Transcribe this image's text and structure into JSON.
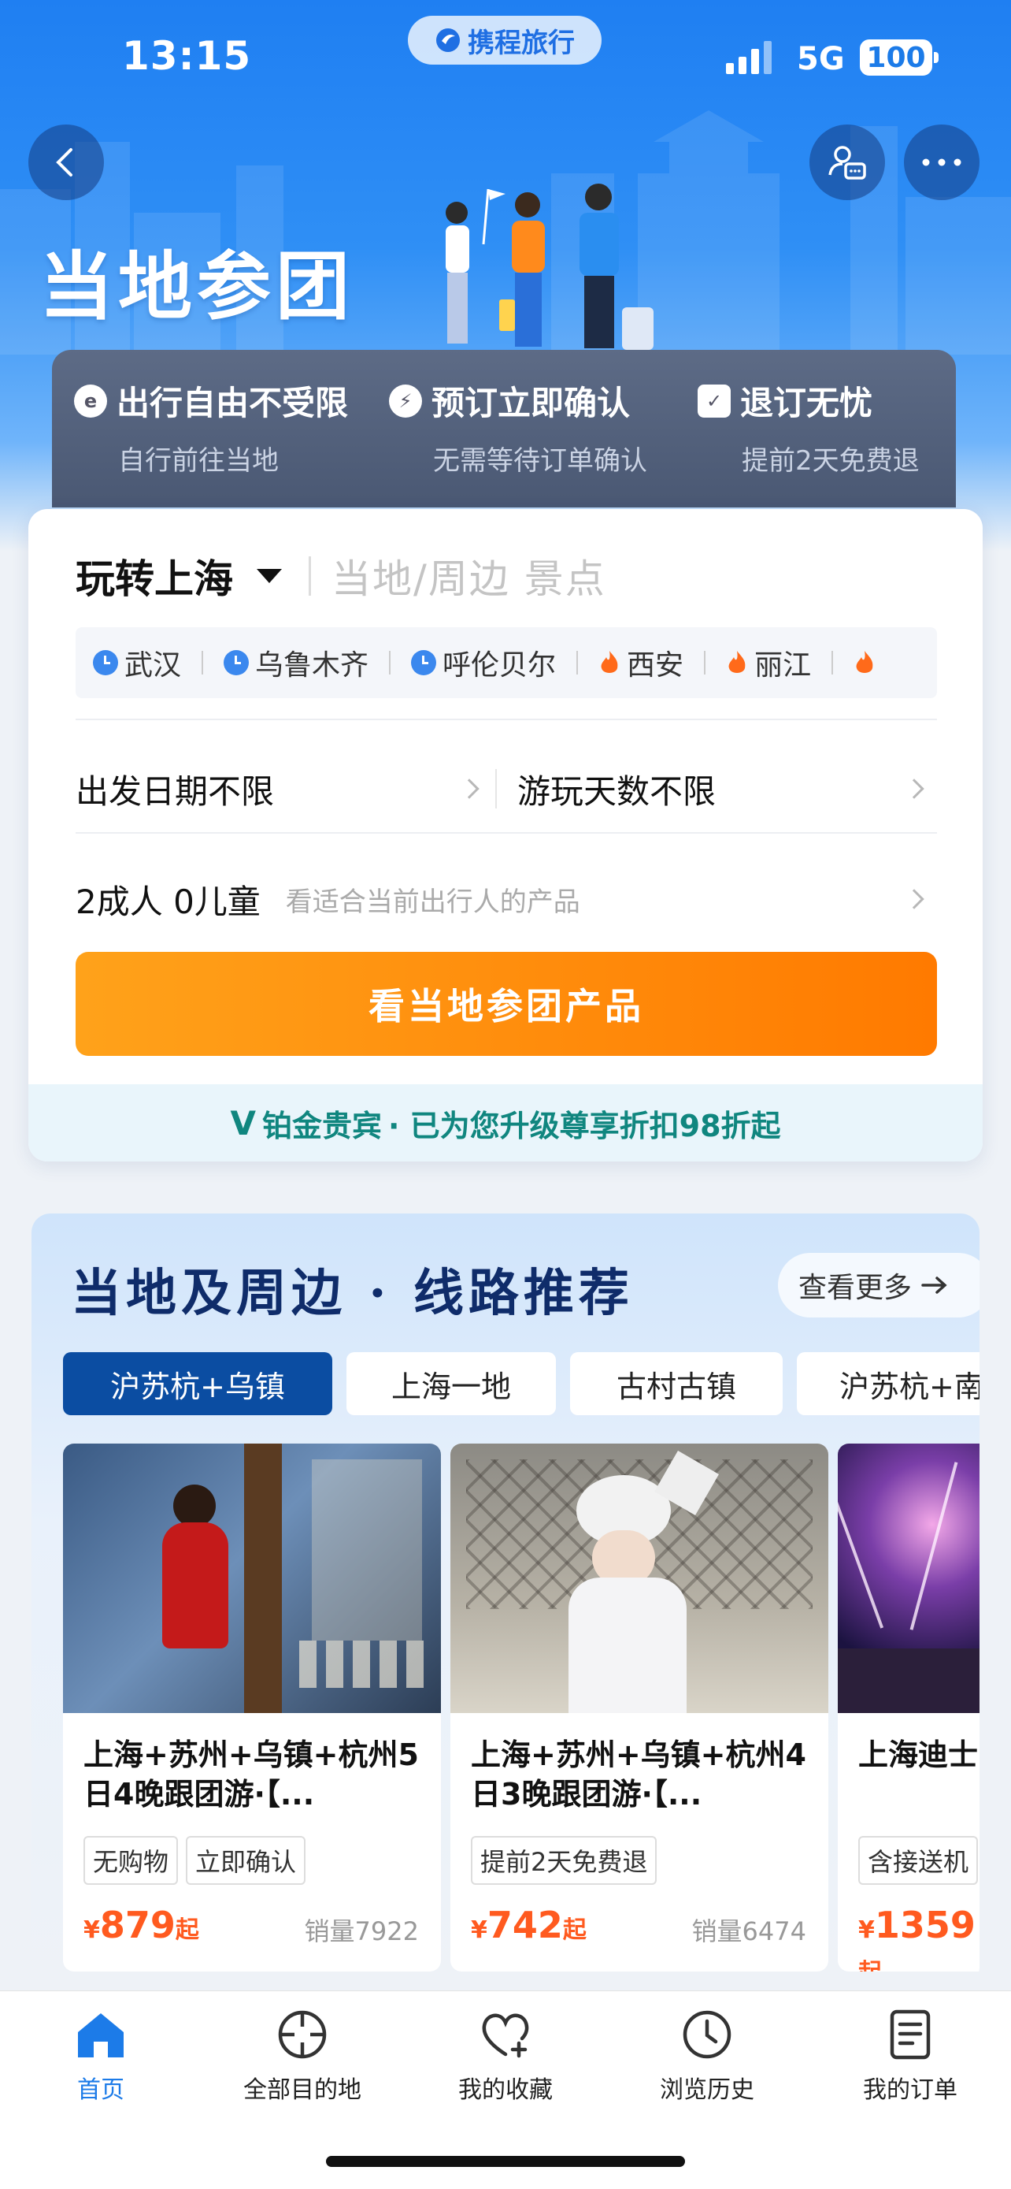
{
  "status": {
    "time": "13:15",
    "network": "5G",
    "battery": "100"
  },
  "brand": {
    "name": "携程旅行"
  },
  "header": {
    "title": "当地参团"
  },
  "benefits": [
    {
      "title": "出行自由不受限",
      "sub": "自行前往当地"
    },
    {
      "title": "预订立即确认",
      "sub": "无需等待订单确认"
    },
    {
      "title": "退订无忧",
      "sub": "提前2天免费退"
    }
  ],
  "search": {
    "city": "玩转上海",
    "placeholder": "当地/周边 景点",
    "hot_cities": [
      "武汉",
      "乌鲁木齐",
      "呼伦贝尔",
      "西安",
      "丽江"
    ],
    "date": "出发日期不限",
    "days": "游玩天数不限",
    "pax": "2成人 0儿童",
    "pax_hint": "看适合当前出行人的产品",
    "cta": "看当地参团产品",
    "vip_badge": "铂金贵宾",
    "vip_text": "· 已为您升级尊享折扣98折起"
  },
  "recs": {
    "title": "当地及周边 · 线路推荐",
    "more": "查看更多",
    "tabs": [
      "沪苏杭+乌镇",
      "上海一地",
      "古村古镇",
      "沪苏杭+南"
    ],
    "cards": [
      {
        "title": "上海+苏州+乌镇+杭州5日4晚跟团游·【...",
        "tags": [
          "无购物",
          "立即确认"
        ],
        "currency": "¥",
        "price": "879",
        "suffix": "起",
        "sales": "销量7922"
      },
      {
        "title": "上海+苏州+乌镇+杭州4日3晚跟团游·【...",
        "tags": [
          "提前2天免费退"
        ],
        "currency": "¥",
        "price": "742",
        "suffix": "起",
        "sales": "销量6474"
      },
      {
        "title": "上海迪士+苏州+",
        "tags": [
          "含接送机"
        ],
        "currency": "¥",
        "price": "1359",
        "suffix": "起",
        "sales": ""
      }
    ]
  },
  "tabbar": [
    {
      "label": "首页",
      "icon": "home-icon",
      "active": true
    },
    {
      "label": "全部目的地",
      "icon": "target-icon",
      "active": false
    },
    {
      "label": "我的收藏",
      "icon": "heart-plus-icon",
      "active": false
    },
    {
      "label": "浏览历史",
      "icon": "clock-icon",
      "active": false
    },
    {
      "label": "我的订单",
      "icon": "order-list-icon",
      "active": false
    }
  ],
  "colors": {
    "accent": "#1c7be8",
    "cta_start": "#ffa21a",
    "cta_end": "#ff7a00",
    "price": "#ff5a1f",
    "navy": "#0b4da2"
  }
}
